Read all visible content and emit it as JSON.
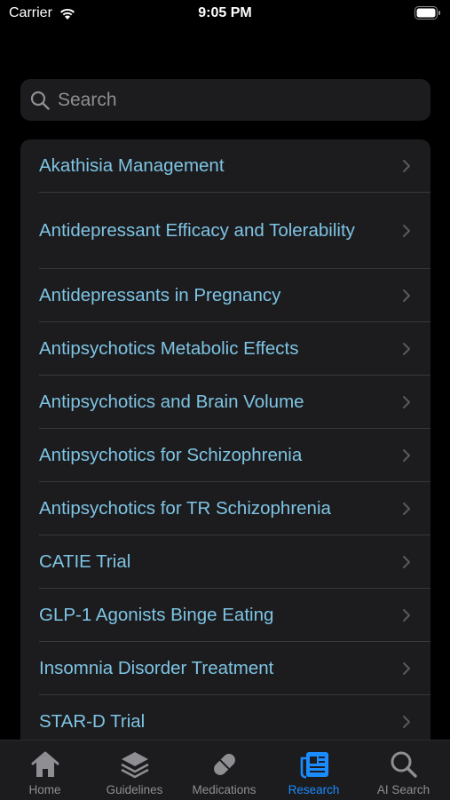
{
  "status_bar": {
    "carrier": "Carrier",
    "time": "9:05 PM"
  },
  "search": {
    "placeholder": "Search"
  },
  "items": [
    "Akathisia Management",
    "Antidepressant Efficacy and Tolerability",
    "Antidepressants in Pregnancy",
    "Antipsychotics Metabolic Effects",
    "Antipsychotics and Brain Volume",
    "Antipsychotics for Schizophrenia",
    "Antipsychotics for TR Schizophrenia",
    "CATIE Trial",
    "GLP-1 Agonists Binge Eating",
    "Insomnia Disorder Treatment",
    "STAR-D Trial"
  ],
  "tabs": [
    {
      "label": "Home",
      "icon": "house-icon",
      "active": false
    },
    {
      "label": "Guidelines",
      "icon": "stack-icon",
      "active": false
    },
    {
      "label": "Medications",
      "icon": "pill-icon",
      "active": false
    },
    {
      "label": "Research",
      "icon": "newspaper-icon",
      "active": true
    },
    {
      "label": "AI Search",
      "icon": "magnifier-icon",
      "active": false
    }
  ],
  "colors": {
    "link": "#7ec4e4",
    "active_tab": "#1a8cff",
    "inactive_tab": "#8e8e93"
  }
}
